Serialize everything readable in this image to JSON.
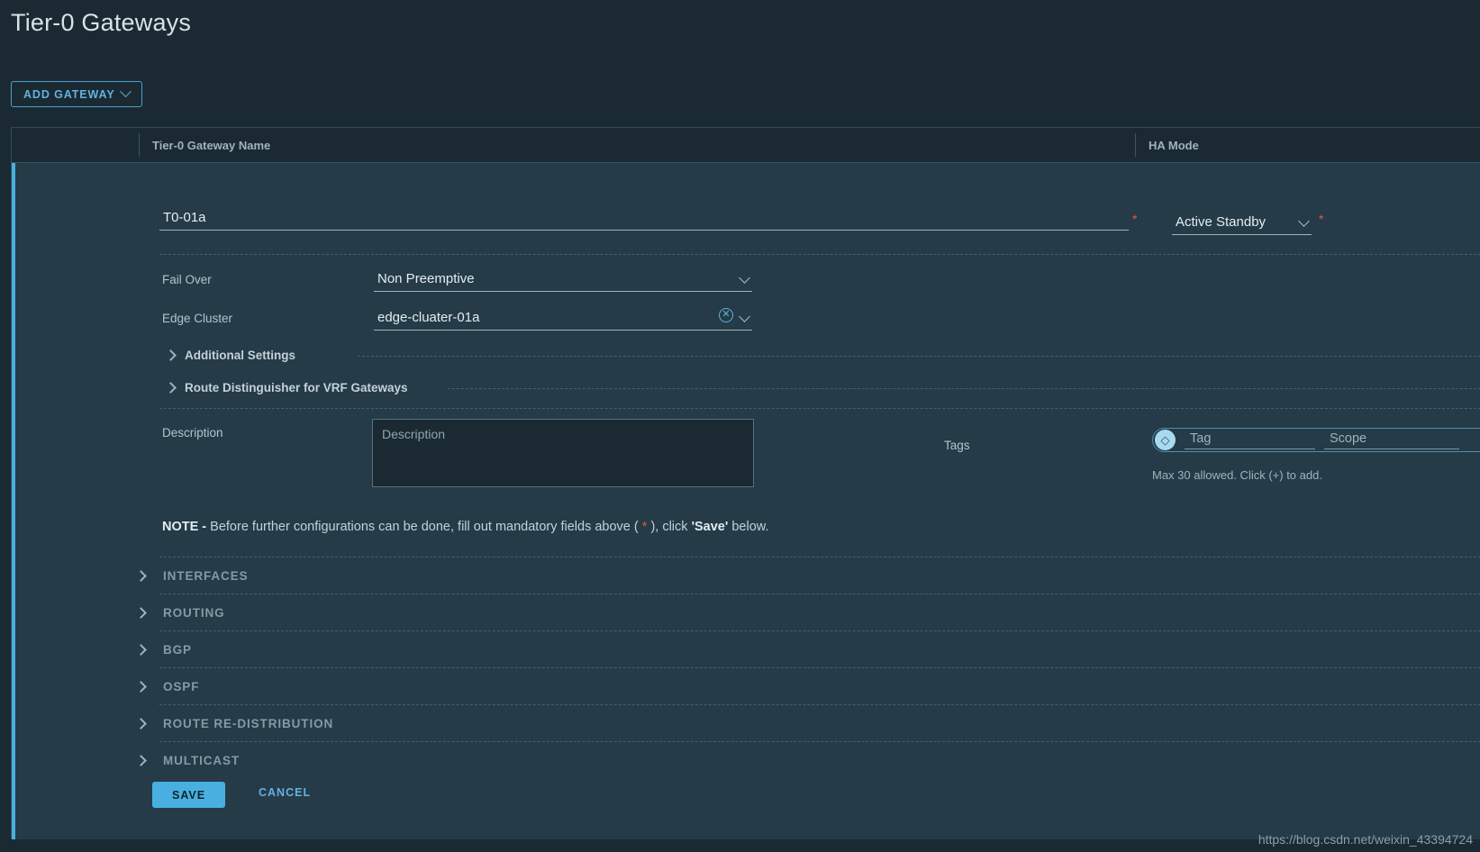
{
  "page": {
    "title": "Tier-0 Gateways",
    "watermark": "https://blog.csdn.net/weixin_43394724"
  },
  "toolbar": {
    "add_gateway_label": "ADD GATEWAY",
    "add_gateway_icon": "chevron-down-icon"
  },
  "grid": {
    "columns": {
      "name": "Tier-0 Gateway Name",
      "ha_mode": "HA Mode"
    }
  },
  "form": {
    "gateway_name": {
      "value": "T0-01a",
      "placeholder": "Tier-0 Gateway Name",
      "required_marker": "*"
    },
    "ha_mode": {
      "value": "Active Standby",
      "required_marker": "*",
      "caret_icon": "chevron-down-icon"
    },
    "fail_over": {
      "label": "Fail Over",
      "value": "Non Preemptive",
      "caret_icon": "chevron-down-icon"
    },
    "edge_cluster": {
      "label": "Edge Cluster",
      "value": "edge-cluater-01a",
      "clear_icon": "close-circle-icon",
      "caret_icon": "chevron-down-icon"
    },
    "sub_sections": [
      {
        "label": "Additional Settings",
        "icon": "chevron-right-icon"
      },
      {
        "label": "Route Distinguisher for VRF Gateways",
        "icon": "chevron-right-icon"
      }
    ],
    "description": {
      "label": "Description",
      "value": "",
      "placeholder": "Description"
    },
    "tags": {
      "label": "Tags",
      "icon": "tag-icon",
      "tag_placeholder": "Tag",
      "scope_placeholder": "Scope",
      "tag_value": "",
      "scope_value": "",
      "hint": "Max 30 allowed. Click (+) to add."
    },
    "note": {
      "prefix": "NOTE - ",
      "text_before_star": "Before further configurations can be done, fill out mandatory fields above ( ",
      "star": "*",
      "text_after_star": " ), click ",
      "save_quoted": "'Save'",
      "text_end": " below."
    },
    "sections": [
      {
        "label": "INTERFACES",
        "icon": "chevron-right-icon"
      },
      {
        "label": "ROUTING",
        "icon": "chevron-right-icon"
      },
      {
        "label": "BGP",
        "icon": "chevron-right-icon"
      },
      {
        "label": "OSPF",
        "icon": "chevron-right-icon"
      },
      {
        "label": "ROUTE RE-DISTRIBUTION",
        "icon": "chevron-right-icon"
      },
      {
        "label": "MULTICAST",
        "icon": "chevron-right-icon"
      }
    ],
    "actions": {
      "save": "SAVE",
      "cancel": "CANCEL"
    }
  },
  "colors": {
    "accent": "#49afe0",
    "required": "#e8583e",
    "row_bg": "#253b47",
    "page_bg": "#1b2a32"
  }
}
